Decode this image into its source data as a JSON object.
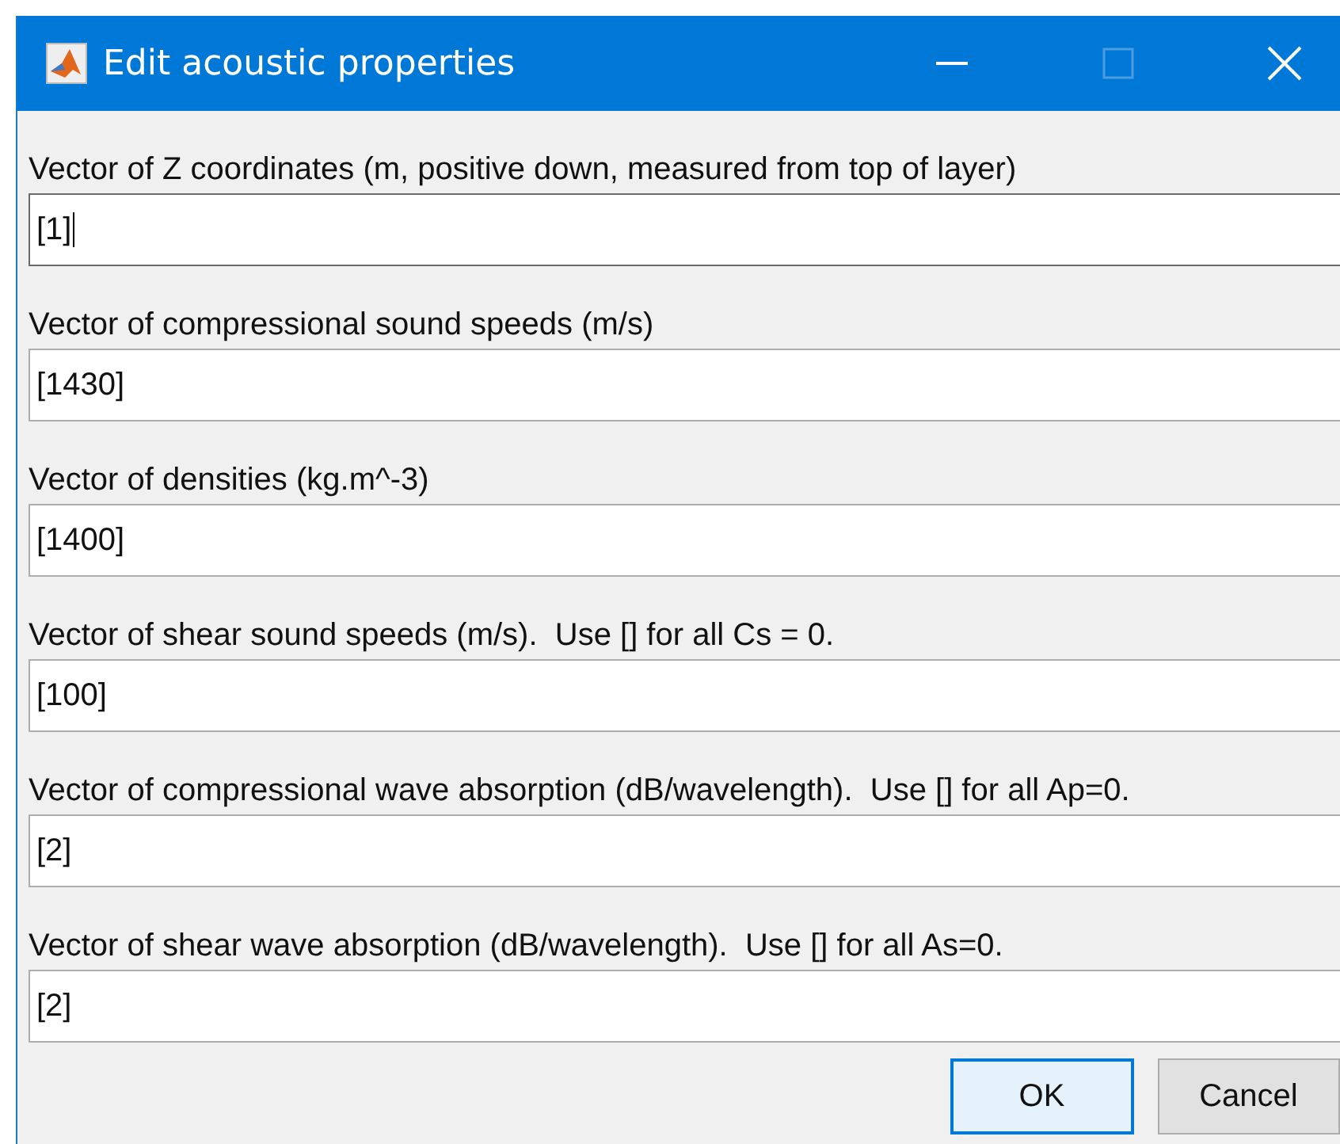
{
  "window": {
    "title": "Edit acoustic properties"
  },
  "fields": [
    {
      "label": "Vector of Z coordinates (m, positive down, measured from top of layer)",
      "value": "[1]",
      "focused": true
    },
    {
      "label": "Vector of compressional sound speeds (m/s)",
      "value": "[1430]",
      "focused": false
    },
    {
      "label": "Vector of densities (kg.m^-3)",
      "value": "[1400]",
      "focused": false
    },
    {
      "label": "Vector of shear sound speeds (m/s).  Use [] for all Cs = 0.",
      "value": "[100]",
      "focused": false
    },
    {
      "label": "Vector of compressional wave absorption (dB/wavelength).  Use [] for all Ap=0.",
      "value": "[2]",
      "focused": false
    },
    {
      "label": "Vector of shear wave absorption (dB/wavelength).  Use [] for all As=0.",
      "value": "[2]",
      "focused": false
    }
  ],
  "buttons": [
    {
      "label": "OK",
      "default": true
    },
    {
      "label": "Cancel",
      "default": false
    }
  ]
}
